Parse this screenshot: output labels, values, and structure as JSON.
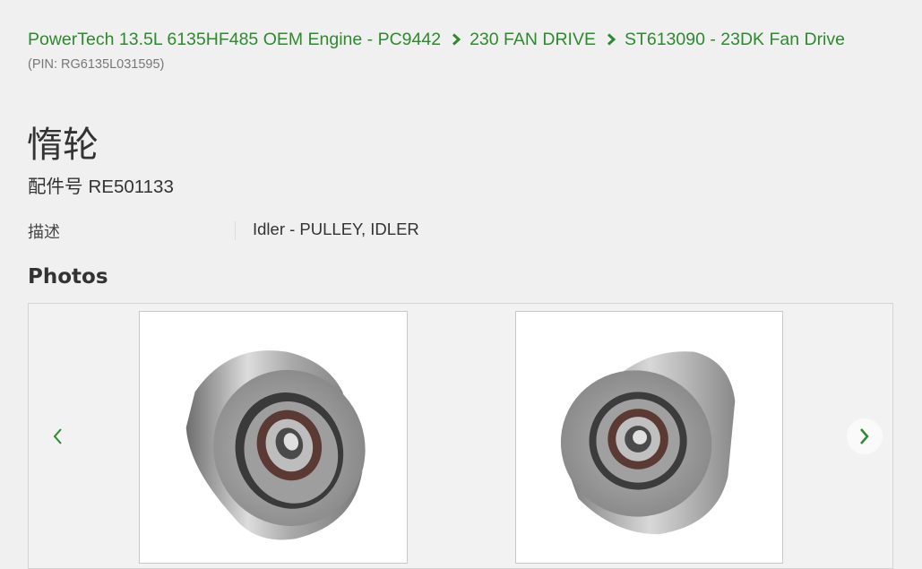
{
  "breadcrumb": {
    "items": [
      {
        "label": "PowerTech 13.5L 6135HF485 OEM Engine - PC9442"
      },
      {
        "label": "230 FAN DRIVE"
      },
      {
        "label": "ST613090 - 23DK Fan Drive"
      }
    ],
    "separator_icon": "chevron-right-icon",
    "pin": "(PIN: RG6135L031595)"
  },
  "part": {
    "title": "惰轮",
    "number_label": "配件号",
    "number": "RE501133",
    "description_label": "描述",
    "description": "Idler - PULLEY, IDLER"
  },
  "photos": {
    "heading": "Photos",
    "prev_icon": "chevron-left-icon",
    "next_icon": "chevron-right-icon",
    "images": [
      {
        "alt": "idler-pulley-image"
      },
      {
        "alt": "idler-pulley-image"
      }
    ]
  },
  "colors": {
    "link": "#2d8a2d",
    "background": "#f0f0f0"
  }
}
